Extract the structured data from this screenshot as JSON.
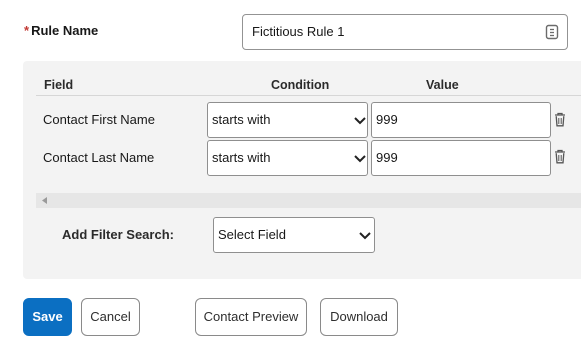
{
  "rule": {
    "required_marker": "*",
    "label": "Rule Name",
    "value": "Fictitious Rule 1"
  },
  "filter": {
    "headers": {
      "field": "Field",
      "condition": "Condition",
      "value": "Value"
    },
    "rows": [
      {
        "field": "Contact First Name",
        "condition": "starts with",
        "value": "999"
      },
      {
        "field": "Contact Last Name",
        "condition": "starts with",
        "value": "999"
      }
    ],
    "add_filter_label": "Add Filter Search:",
    "select_field_value": "Select Field"
  },
  "buttons": {
    "save": "Save",
    "cancel": "Cancel",
    "contact_preview": "Contact Preview",
    "download": "Download"
  },
  "colors": {
    "primary": "#0b6fc2",
    "required": "#c23934",
    "panel_bg": "#f3f3f3"
  },
  "icons": {
    "rule_input": "badge-icon",
    "dropdown": "chevron-down-icon",
    "delete": "trash-icon",
    "scroll": "scroll-left-arrow-icon"
  }
}
